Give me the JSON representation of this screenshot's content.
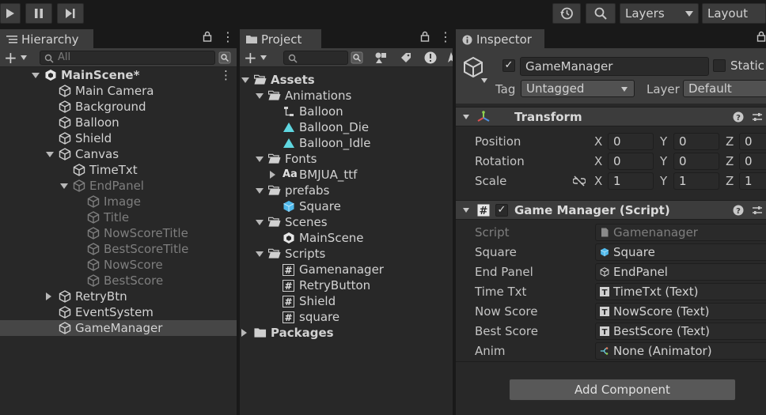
{
  "toolbar": {
    "layers_label": "Layers",
    "layout_label": "Layout"
  },
  "hierarchy": {
    "tab_label": "Hierarchy",
    "search_placeholder": "All",
    "rows": [
      {
        "label": "MainScene*",
        "indent": 0,
        "fold": "down",
        "icon": "unity-scene-icon",
        "bold": true
      },
      {
        "label": "Main Camera",
        "indent": 1,
        "icon": "cube-icon"
      },
      {
        "label": "Background",
        "indent": 1,
        "icon": "cube-icon"
      },
      {
        "label": "Balloon",
        "indent": 1,
        "icon": "cube-icon"
      },
      {
        "label": "Shield",
        "indent": 1,
        "icon": "cube-icon"
      },
      {
        "label": "Canvas",
        "indent": 1,
        "fold": "down",
        "icon": "cube-icon"
      },
      {
        "label": "TimeTxt",
        "indent": 2,
        "icon": "cube-icon"
      },
      {
        "label": "EndPanel",
        "indent": 2,
        "fold": "down",
        "icon": "cube-icon",
        "dim": true
      },
      {
        "label": "Image",
        "indent": 3,
        "icon": "cube-icon",
        "dim": true
      },
      {
        "label": "Title",
        "indent": 3,
        "icon": "cube-icon",
        "dim": true
      },
      {
        "label": "NowScoreTitle",
        "indent": 3,
        "icon": "cube-icon",
        "dim": true
      },
      {
        "label": "BestScoreTitle",
        "indent": 3,
        "icon": "cube-icon",
        "dim": true
      },
      {
        "label": "NowScore",
        "indent": 3,
        "icon": "cube-icon",
        "dim": true
      },
      {
        "label": "BestScore",
        "indent": 3,
        "icon": "cube-icon",
        "dim": true
      },
      {
        "label": "RetryBtn",
        "indent": 1,
        "fold": "right",
        "icon": "cube-icon"
      },
      {
        "label": "EventSystem",
        "indent": 1,
        "icon": "cube-icon"
      },
      {
        "label": "GameManager",
        "indent": 1,
        "icon": "cube-icon",
        "selected": true
      }
    ]
  },
  "project": {
    "tab_label": "Project",
    "rows": [
      {
        "label": "Assets",
        "indent": 0,
        "fold": "down",
        "icon": "folder-open-icon",
        "bold": true
      },
      {
        "label": "Animations",
        "indent": 1,
        "fold": "down",
        "icon": "folder-open-icon"
      },
      {
        "label": "Balloon",
        "indent": 2,
        "icon": "animator-controller-icon"
      },
      {
        "label": "Balloon_Die",
        "indent": 2,
        "icon": "animation-clip-icon"
      },
      {
        "label": "Balloon_Idle",
        "indent": 2,
        "icon": "animation-clip-icon"
      },
      {
        "label": "Fonts",
        "indent": 1,
        "fold": "down",
        "icon": "folder-open-icon"
      },
      {
        "label": "BMJUA_ttf",
        "indent": 2,
        "fold": "right",
        "icon": "font-icon",
        "icon_text": "Aa"
      },
      {
        "label": "prefabs",
        "indent": 1,
        "fold": "down",
        "icon": "folder-open-icon"
      },
      {
        "label": "Square",
        "indent": 2,
        "icon": "prefab-icon"
      },
      {
        "label": "Scenes",
        "indent": 1,
        "fold": "down",
        "icon": "folder-open-icon"
      },
      {
        "label": "MainScene",
        "indent": 2,
        "icon": "unity-scene-icon"
      },
      {
        "label": "Scripts",
        "indent": 1,
        "fold": "down",
        "icon": "folder-open-icon"
      },
      {
        "label": "Gamenanager",
        "indent": 2,
        "icon": "script-icon",
        "icon_text": "#"
      },
      {
        "label": "RetryButton",
        "indent": 2,
        "icon": "script-icon",
        "icon_text": "#"
      },
      {
        "label": "Shield",
        "indent": 2,
        "icon": "script-icon",
        "icon_text": "#"
      },
      {
        "label": "square",
        "indent": 2,
        "icon": "script-icon",
        "icon_text": "#"
      },
      {
        "label": "Packages",
        "indent": 0,
        "fold": "right",
        "icon": "folder-icon",
        "bold": true
      }
    ]
  },
  "inspector": {
    "tab_label": "Inspector",
    "object_name": "GameManager",
    "static_label": "Static",
    "tag_label": "Tag",
    "tag_value": "Untagged",
    "layer_label": "Layer",
    "layer_value": "Default",
    "transform": {
      "title": "Transform",
      "rows": [
        {
          "label": "Position",
          "x": "0",
          "y": "0",
          "z": "0"
        },
        {
          "label": "Rotation",
          "x": "0",
          "y": "0",
          "z": "0"
        },
        {
          "label": "Scale",
          "x": "1",
          "y": "1",
          "z": "1"
        }
      ],
      "axis_x": "X",
      "axis_y": "Y",
      "axis_z": "Z"
    },
    "script": {
      "title": "Game Manager (Script)",
      "fields": [
        {
          "label": "Script",
          "value": "Gamenanager",
          "icon": "script-asset-icon",
          "dim": true
        },
        {
          "label": "Square",
          "value": "Square",
          "icon": "prefab-icon"
        },
        {
          "label": "End Panel",
          "value": "EndPanel",
          "icon": "cube-icon"
        },
        {
          "label": "Time Txt",
          "value": "TimeTxt (Text)",
          "icon": "text-icon",
          "icon_text": "T"
        },
        {
          "label": "Now Score",
          "value": "NowScore (Text)",
          "icon": "text-icon",
          "icon_text": "T"
        },
        {
          "label": "Best Score",
          "value": "BestScore (Text)",
          "icon": "text-icon",
          "icon_text": "T"
        },
        {
          "label": "Anim",
          "value": "None (Animator)",
          "icon": "animator-icon"
        }
      ]
    },
    "add_component_label": "Add Component"
  }
}
